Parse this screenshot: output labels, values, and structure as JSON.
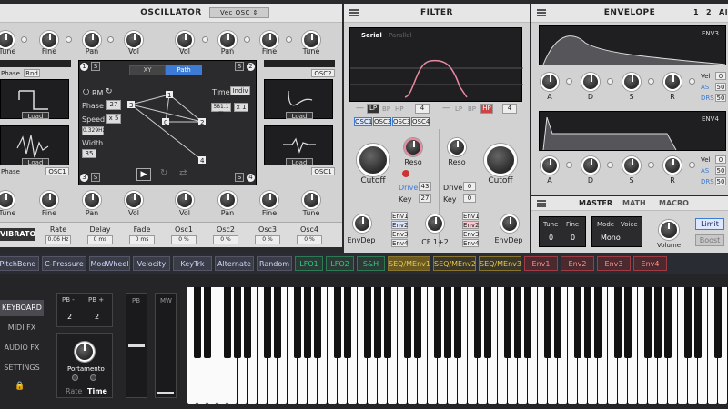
{
  "colors": {
    "accent": "#3c7bd6",
    "filter_curve": "#e98aa0",
    "env_lfo": "#33cc88",
    "env_seq": "#e8c84a",
    "env_env": "#e85060"
  },
  "osc": {
    "title": "OSCILLATOR",
    "mode": "Vec OSC",
    "left_labels": [
      "Tune",
      "Fine",
      "Pan",
      "Vol"
    ],
    "right_labels": [
      "Vol",
      "Pan",
      "Fine",
      "Tune"
    ],
    "bottom_left_labels": [
      "Tune",
      "Fine",
      "Pan",
      "Vol"
    ],
    "bottom_right_labels": [
      "Vol",
      "Pan",
      "Fine",
      "Tune"
    ],
    "tab_xy": "XY",
    "tab_path": "Path",
    "rm": "RM",
    "phase_label": "Phase",
    "phase_val": "27",
    "speed_label": "Speed",
    "speed_val": "x 5",
    "rate_val": "0.329Hz",
    "width_label": "Width",
    "width_val": "35",
    "time_label": "Time",
    "time_val": "Indiv",
    "time_box": "581.1 m",
    "time_mult": "x 1",
    "corner1": "1",
    "corner2": "2",
    "corner3": "3",
    "corner4": "4",
    "s": "S",
    "phase": "Phase",
    "rnd": "Rnd",
    "load": "Load",
    "osc1": "OSC1",
    "osc2": "OSC2",
    "path_points": [
      "1",
      "2",
      "3",
      "4",
      "0"
    ],
    "lfo_name": "VIBRATO",
    "vib": [
      {
        "label": "Rate",
        "val": "0.06 Hz"
      },
      {
        "label": "Delay",
        "val": "0 ms"
      },
      {
        "label": "Fade",
        "val": "0 ms"
      },
      {
        "label": "Osc1",
        "val": "0 %"
      },
      {
        "label": "Osc2",
        "val": "0 %"
      },
      {
        "label": "Osc3",
        "val": "0 %"
      },
      {
        "label": "Osc4",
        "val": "0 %"
      }
    ]
  },
  "filter": {
    "title": "FILTER",
    "serial": "Serial",
    "parallel": "Parallel",
    "types": [
      "LP",
      "BP",
      "HP"
    ],
    "slope_left": "4",
    "slope_right": "4",
    "sources": [
      "OSC1",
      "OSC2",
      "OSC3",
      "OSC4"
    ],
    "cutoff": "Cutoff",
    "reso": "Reso",
    "drive_label": "Drive",
    "drive_l": "43",
    "key_label": "Key",
    "key_l": "27",
    "drive_r": "0",
    "key_r": "0",
    "envdep": "EnvDep",
    "cf": "CF 1+2",
    "env_btns": [
      "Env1",
      "Env2",
      "Env3",
      "Env4"
    ]
  },
  "envelope": {
    "title": "ENVELOPE",
    "page1": "1",
    "page2": "2",
    "page_all": "All",
    "env3": "ENV3",
    "env4": "ENV4",
    "adsr": [
      "A",
      "D",
      "S",
      "R"
    ],
    "vel_label": "Vel",
    "vel": "0",
    "as_label": "AS",
    "as": "50",
    "drs_label": "DRS",
    "drs": "50",
    "vel2": "0",
    "as2": "50",
    "drs2": "50"
  },
  "master": {
    "tabs": [
      "MASTER",
      "MATH",
      "MACRO"
    ],
    "tune": "Tune",
    "fine": "Fine",
    "tune_val": "0",
    "fine_val": "0",
    "mode": "Mode",
    "voice": "Voice",
    "mode_val": "Mono",
    "volume": "Volume",
    "limit": "Limit",
    "boost": "Boost"
  },
  "mod_bar": [
    "PitchBend",
    "C-Pressure",
    "ModWheel",
    "Velocity",
    "KeyTrk",
    "Alternate",
    "Random",
    "LFO1",
    "LFO2",
    "S&H",
    "SEQ/MEnv1",
    "SEQ/MEnv2",
    "SEQ/MEnv3",
    "Env1",
    "Env2",
    "Env3",
    "Env4"
  ],
  "kb": {
    "nav": [
      "KEYBOARD",
      "MIDI FX",
      "AUDIO FX",
      "SETTINGS"
    ],
    "pbm": "PB -",
    "pbp": "PB +",
    "pbm_val": "2",
    "pbp_val": "2",
    "pb": "PB",
    "mw": "MW",
    "portamento": "Portamento",
    "rate": "Rate",
    "time": "Time"
  }
}
